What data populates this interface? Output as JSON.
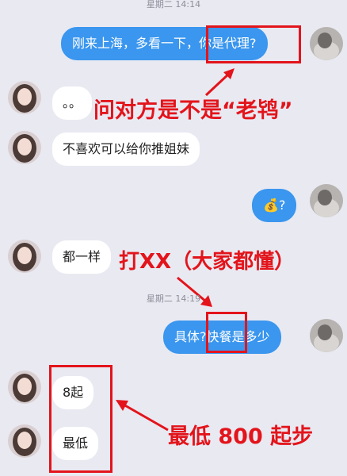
{
  "timestamps": [
    "星期二 14:14",
    "星期二 14:19"
  ],
  "messages": [
    {
      "side": "right",
      "text_before": "刚来上海，多看一下，",
      "text_highlight": "你是代理?"
    },
    {
      "side": "left",
      "text": "。。"
    },
    {
      "side": "left",
      "text": "不喜欢可以给你推姐妹"
    },
    {
      "side": "right",
      "emoji": "💰",
      "text": "?"
    },
    {
      "side": "left",
      "text": "都一样"
    },
    {
      "side": "right",
      "text_before": "具体?",
      "text_highlight": "快餐",
      "text_after": "是多少"
    },
    {
      "side": "left",
      "text": "8起"
    },
    {
      "side": "left",
      "text": "最低"
    }
  ],
  "annotations": {
    "a1": "问对方是不是“老鸨”",
    "a2": "打XX（大家都懂）",
    "a3": "最低 800 起步"
  },
  "colors": {
    "background": "#e9e9f2",
    "bubble_right": "#3a96ee",
    "bubble_left": "#ffffff",
    "annotation_red": "#e3141b"
  },
  "icons": {
    "left_avatar": "woman-profile-avatar",
    "right_avatar": "user-profile-avatar"
  }
}
